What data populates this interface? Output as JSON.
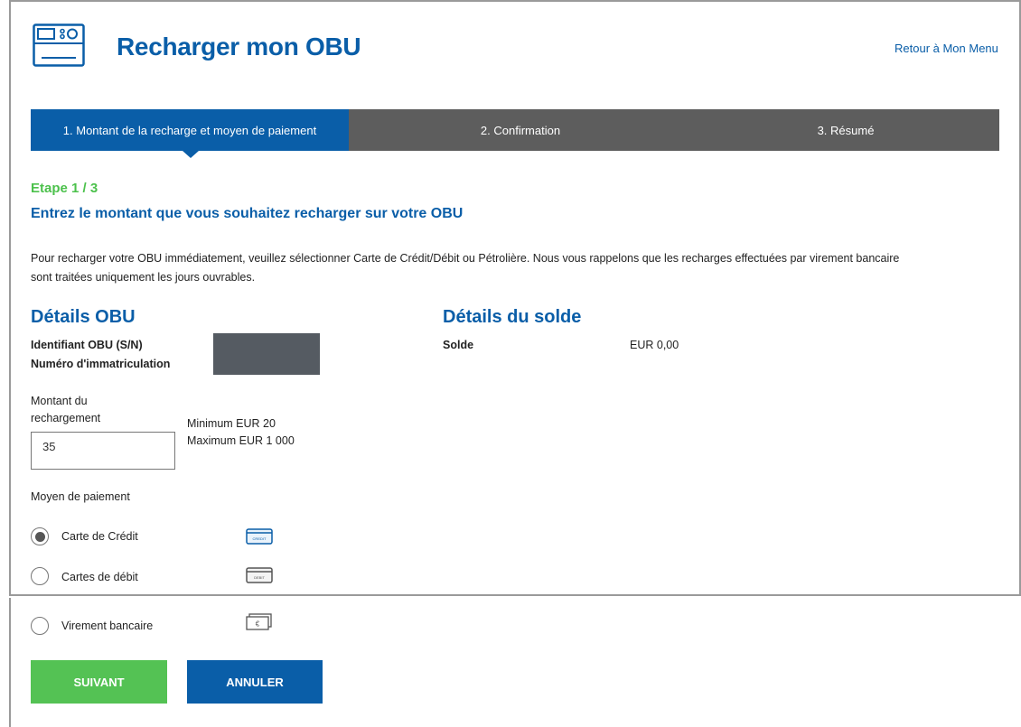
{
  "header": {
    "title": "Recharger mon OBU",
    "back_link": "Retour à Mon Menu"
  },
  "stepper": {
    "steps": [
      {
        "label": "1. Montant de la recharge et moyen de paiement",
        "active": true
      },
      {
        "label": "2. Confirmation",
        "active": false
      },
      {
        "label": "3. Résumé",
        "active": false
      }
    ]
  },
  "intro": {
    "step_indicator": "Etape 1 / 3",
    "headline": "Entrez le montant que vous souhaitez recharger sur votre OBU",
    "info_line1": "Pour recharger votre OBU immédiatement, veuillez sélectionner Carte de Crédit/Débit ou Pétrolière. Nous vous rappelons que les recharges effectuées par virement bancaire",
    "info_line2": "sont traitées uniquement les jours ouvrables."
  },
  "obu_details": {
    "title": "Détails OBU",
    "id_label": "Identifiant OBU (S/N)",
    "plate_label": "Numéro d'immatriculation"
  },
  "balance_details": {
    "title": "Détails du solde",
    "balance_label": "Solde",
    "balance_value": "EUR 0,00"
  },
  "amount": {
    "label_line1": "Montant du",
    "label_line2": "rechargement",
    "value": "35",
    "min": "Minimum EUR 20",
    "max": "Maximum EUR 1 000"
  },
  "payment": {
    "label": "Moyen de paiement",
    "options": [
      {
        "label": "Carte de Crédit",
        "selected": true,
        "icon": "credit-card-icon",
        "icon_text": "CREDIT"
      },
      {
        "label": "Cartes de débit",
        "selected": false,
        "icon": "debit-card-icon",
        "icon_text": "DEBIT"
      },
      {
        "label": "Virement bancaire",
        "selected": false,
        "icon": "bank-transfer-icon",
        "icon_text": "€"
      }
    ]
  },
  "actions": {
    "next": "SUIVANT",
    "cancel": "ANNULER"
  },
  "colors": {
    "brand_blue": "#0a5ea8",
    "success_green": "#54c254",
    "inactive_step": "#5d5d5d"
  }
}
